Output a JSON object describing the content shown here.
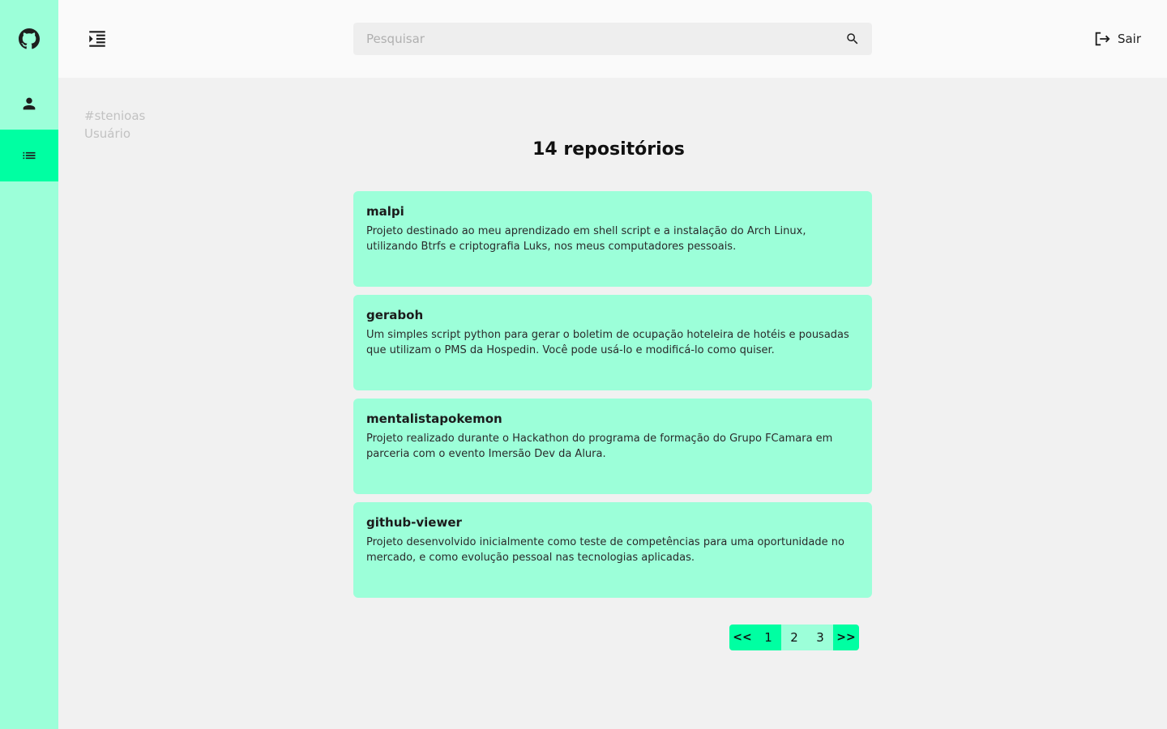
{
  "sidebar": {
    "items": [
      {
        "icon": "github-icon"
      },
      {
        "icon": "person-icon"
      },
      {
        "icon": "list-icon",
        "active": true
      }
    ]
  },
  "header": {
    "search_placeholder": "Pesquisar",
    "logout_label": "Sair"
  },
  "user": {
    "handle": "#stenioas",
    "role": "Usuário"
  },
  "main": {
    "repo_count_title": "14 repositórios",
    "repos": [
      {
        "name": "malpi",
        "description": "Projeto destinado ao meu aprendizado em shell script e a instalação do Arch Linux, utilizando Btrfs e criptografia Luks, nos meus computadores pessoais."
      },
      {
        "name": "geraboh",
        "description": "Um simples script python para gerar o boletim de ocupação hoteleira de hotéis e pousadas que utilizam o PMS da Hospedin. Você pode usá-lo e modificá-lo como quiser."
      },
      {
        "name": "mentalistapokemon",
        "description": "Projeto realizado durante o Hackathon do programa de formação do Grupo FCamara em parceria com o evento Imersão Dev da Alura."
      },
      {
        "name": "github-viewer",
        "description": "Projeto desenvolvido inicialmente como teste de competências para uma oportunidade no mercado, e como evolução pessoal nas tecnologias aplicadas."
      }
    ]
  },
  "pagination": {
    "prev_label": "<<",
    "next_label": ">>",
    "pages": [
      "1",
      "2",
      "3"
    ],
    "current": "1"
  },
  "colors": {
    "sidebar_bg": "#9cffd9",
    "accent": "#00ffa2",
    "card_bg": "#9cffd9"
  }
}
